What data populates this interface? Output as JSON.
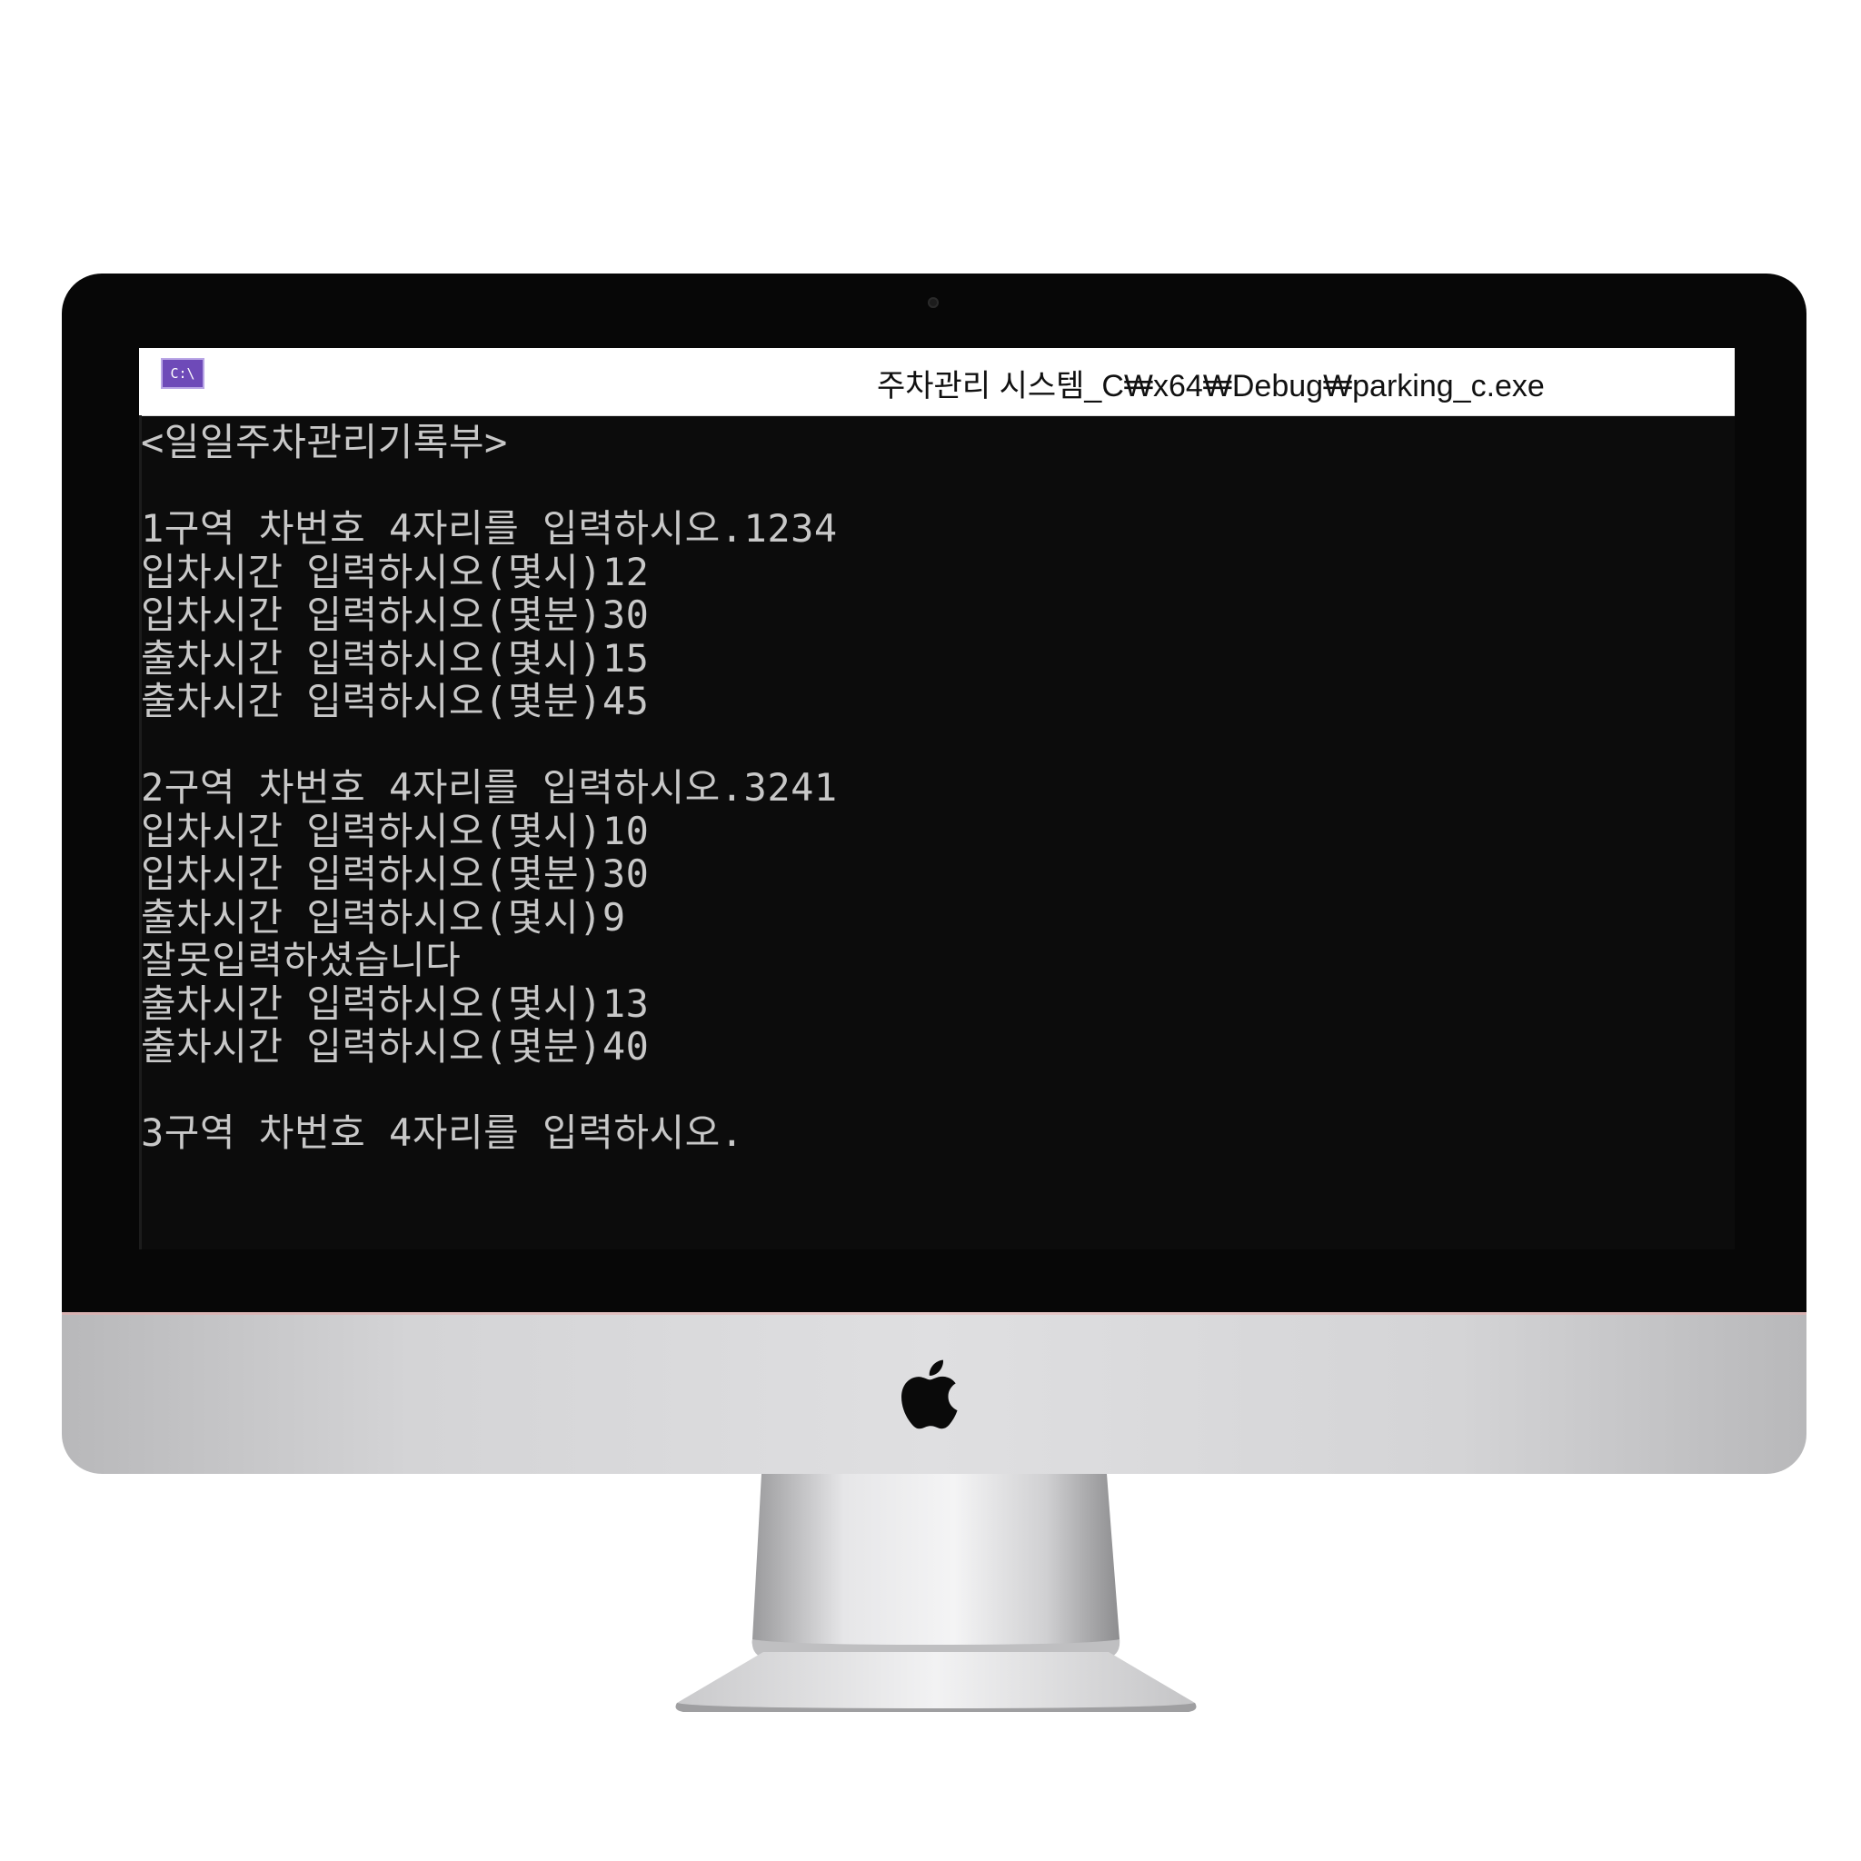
{
  "window": {
    "icon_label": "C:\\",
    "title": "주차관리 시스템_C₩x64₩Debug₩parking_c.exe"
  },
  "console": {
    "lines": [
      "<일일주차관리기록부>",
      "",
      "1구역 차번호 4자리를 입력하시오.1234",
      "입차시간 입력하시오(몇시)12",
      "입차시간 입력하시오(몇분)30",
      "출차시간 입력하시오(몇시)15",
      "출차시간 입력하시오(몇분)45",
      "",
      "2구역 차번호 4자리를 입력하시오.3241",
      "입차시간 입력하시오(몇시)10",
      "입차시간 입력하시오(몇분)30",
      "출차시간 입력하시오(몇시)9",
      "잘못입력하셨습니다",
      "출차시간 입력하시오(몇시)13",
      "출차시간 입력하시오(몇분)40",
      "",
      "3구역 차번호 4자리를 입력하시오."
    ]
  },
  "device": {
    "logo": "apple-logo-icon"
  }
}
